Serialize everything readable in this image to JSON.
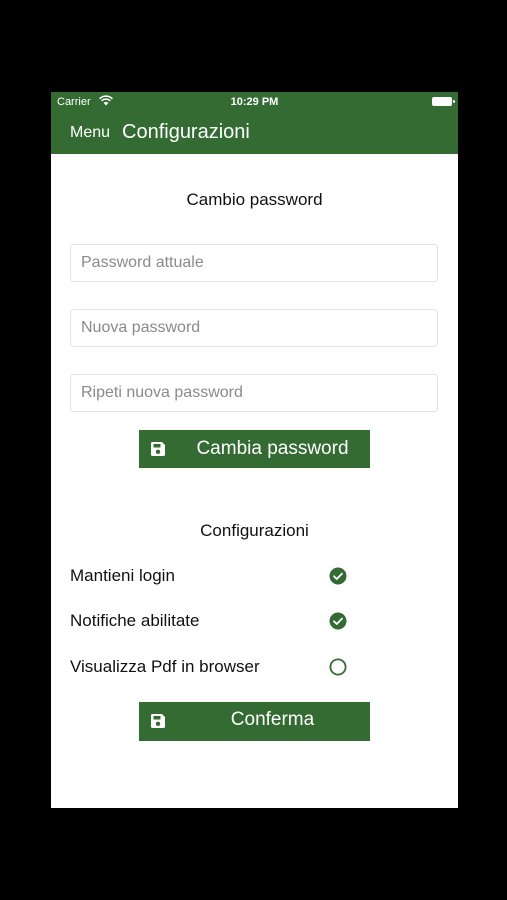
{
  "status_bar": {
    "carrier": "Carrier",
    "time": "10:29 PM"
  },
  "nav": {
    "menu_label": "Menu",
    "title": "Configurazioni"
  },
  "password_section": {
    "title": "Cambio password",
    "current_placeholder": "Password attuale",
    "new_placeholder": "Nuova password",
    "repeat_placeholder": "Ripeti nuova password",
    "button_label": "Cambia password"
  },
  "config_section": {
    "title": "Configurazioni",
    "options": [
      {
        "label": "Mantieni login",
        "checked": true
      },
      {
        "label": "Notifiche abilitate",
        "checked": true
      },
      {
        "label": "Visualizza Pdf in browser",
        "checked": false
      }
    ],
    "confirm_label": "Conferma"
  },
  "colors": {
    "accent": "#336b33",
    "background": "#ffffff"
  },
  "icons": {
    "save_button_icon": "floppy-disk-icon",
    "checked_icon": "check-circle-icon",
    "unchecked_icon": "empty-circle-icon"
  }
}
